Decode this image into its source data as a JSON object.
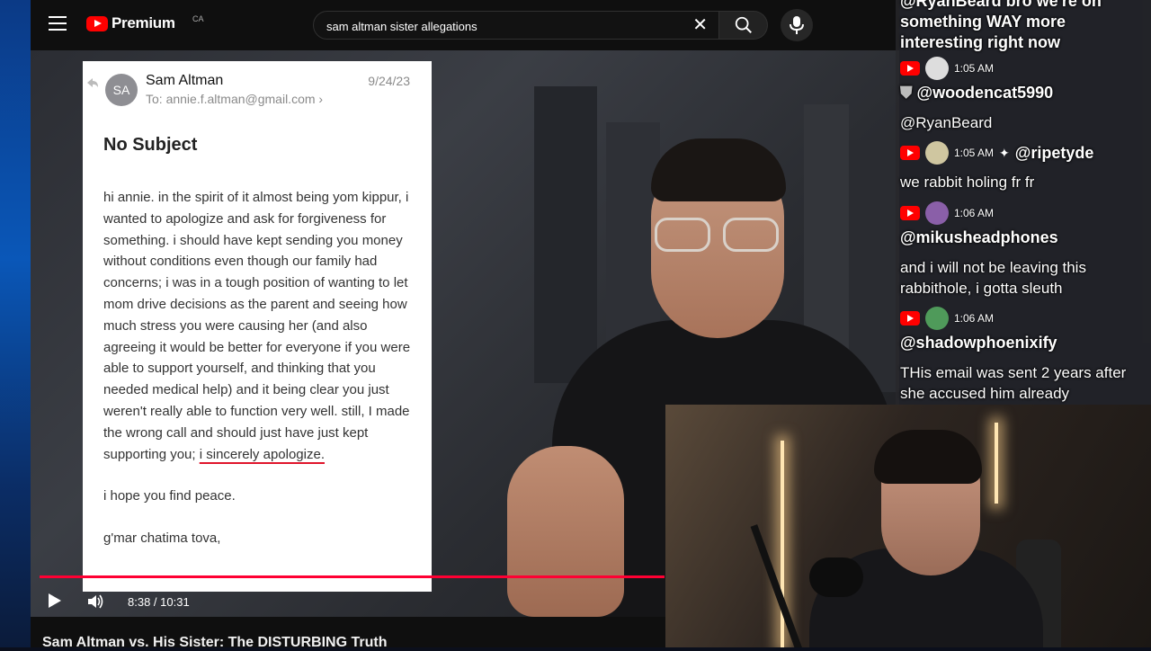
{
  "app": {
    "logo_text": "Premium",
    "country": "CA"
  },
  "search": {
    "value": "sam altman sister allegations",
    "clear_icon": "close-icon"
  },
  "email": {
    "avatar_initials": "SA",
    "sender": "Sam Altman",
    "to": "To: annie.f.altman@gmail.com",
    "date": "9/24/23",
    "subject": "No Subject",
    "body": "hi annie. in the spirit of it almost being yom kippur, i wanted to apologize and ask for forgiveness for something. i should have kept sending you money without conditions even though our family had concerns; i was in a tough position of wanting to let mom drive decisions as the parent and seeing how much stress you were causing her (and also agreeing it would be better for everyone if you were  able to support yourself, and thinking that you needed medical help) and it being clear you just weren't really able to function very well. still, I made the wrong call and should just have just kept supporting you;",
    "apology": "i sincerely apologize.",
    "peace": "i hope you find peace.",
    "signoff": "g'mar chatima tova,"
  },
  "player": {
    "time": "8:38 / 10:31",
    "progress": 0.822
  },
  "video": {
    "title": "Sam Altman vs. His Sister: The DISTURBING Truth"
  },
  "chat": {
    "top_line_1": "@RyanBeard bro we're on",
    "top_line_2": "something WAY more",
    "top_line_3": "interesting right now",
    "messages": [
      {
        "time": "1:05 AM",
        "user": "@woodencat5990",
        "text": "@RyanBeard"
      },
      {
        "time": "1:05 AM",
        "user": "@ripetyde",
        "text": "we rabbit holing fr fr"
      },
      {
        "time": "1:06 AM",
        "user": "@mikusheadphones",
        "text": "and i will not be leaving this rabbithole, i gotta sleuth"
      },
      {
        "time": "1:06 AM",
        "user": "@shadowphoenixify",
        "text": "THis email was sent 2 years after she accused him already"
      }
    ]
  },
  "colors": {
    "youtube_red": "#ff0000",
    "progress_red": "#ff0033",
    "underline_red": "#e0142b"
  }
}
